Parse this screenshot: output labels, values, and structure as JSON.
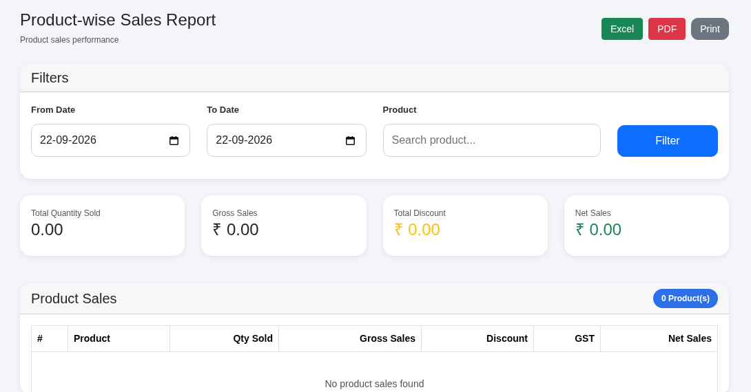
{
  "header": {
    "title": "Product-wise Sales Report",
    "subtitle": "Product sales performance"
  },
  "export_buttons": [
    {
      "label": "Excel",
      "kind": "excel"
    },
    {
      "label": "PDF",
      "kind": "pdf"
    },
    {
      "label": "Print",
      "kind": "print"
    }
  ],
  "filters": {
    "title": "Filters",
    "fields": [
      {
        "label": "From Date",
        "kind": "date",
        "value": "22-09-2026"
      },
      {
        "label": "To Date",
        "kind": "date",
        "value": "22-09-2026"
      },
      {
        "label": "Product",
        "kind": "search",
        "placeholder": "Search product..."
      }
    ],
    "submit": "Filter"
  },
  "summary_cards": [
    {
      "label": "Total Quantity Sold",
      "value": "0.00",
      "color": "#212529"
    },
    {
      "label": "Gross Sales",
      "value": "₹ 0.00",
      "color": "#212529"
    },
    {
      "label": "Total Discount",
      "value": "₹ 0.00",
      "color": "#ffc107"
    },
    {
      "label": "Net Sales",
      "value": "₹ 0.00",
      "color": "#198754"
    }
  ],
  "product_sales": {
    "title": "Product Sales",
    "count_badge": "0 Product(s)",
    "table": {
      "columns": [
        {
          "label": "#",
          "right_aligned": false
        },
        {
          "label": "Product",
          "right_aligned": false
        },
        {
          "label": "Qty Sold",
          "right_aligned": true
        },
        {
          "label": "Gross Sales",
          "right_aligned": true
        },
        {
          "label": "Discount",
          "right_aligned": true
        },
        {
          "label": "GST",
          "right_aligned": true
        },
        {
          "label": "Net Sales",
          "right_aligned": true
        }
      ],
      "empty_message": "No product sales found"
    }
  }
}
